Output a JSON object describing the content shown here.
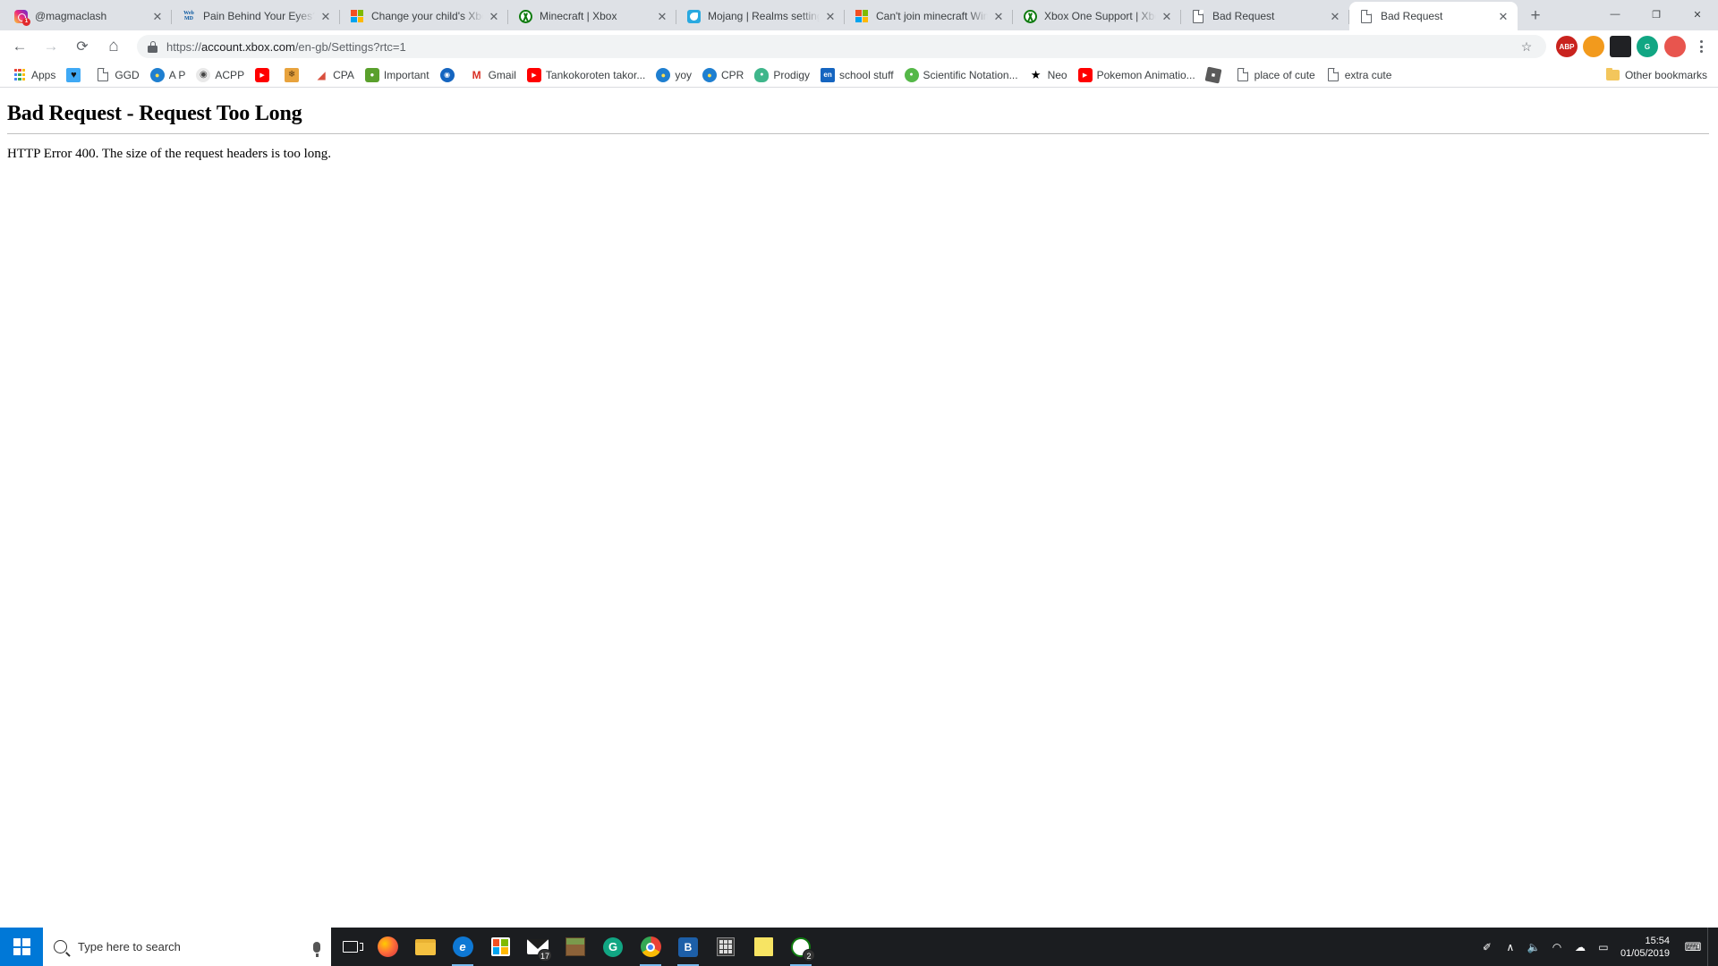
{
  "browser": {
    "tabs": [
      {
        "title": "@magmaclash",
        "favicon": "instagram-icon",
        "badge": "1",
        "active": false
      },
      {
        "title": "Pain Behind Your Eyes?",
        "favicon": "webmd-icon",
        "active": false
      },
      {
        "title": "Change your child's Xbox",
        "favicon": "microsoft-icon",
        "active": false
      },
      {
        "title": "Minecraft | Xbox",
        "favicon": "xbox-icon",
        "active": false
      },
      {
        "title": "Mojang | Realms settings",
        "favicon": "mojang-icon",
        "active": false
      },
      {
        "title": "Can't join minecraft Win",
        "favicon": "microsoft-icon",
        "active": false
      },
      {
        "title": "Xbox One Support | Xbox",
        "favicon": "xbox-icon",
        "active": false
      },
      {
        "title": "Bad Request",
        "favicon": "generic-page-icon",
        "active": false
      },
      {
        "title": "Bad Request",
        "favicon": "generic-page-icon",
        "active": true
      }
    ],
    "new_tab_label": "+",
    "window_controls": {
      "minimize": "—",
      "maximize": "❐",
      "close": "✕"
    },
    "toolbar": {
      "back_label": "←",
      "forward_label": "→",
      "reload_label": "⟳",
      "home_label": "⌂",
      "url_scheme": "https://",
      "url_host": "account.xbox.com",
      "url_path": "/en-gb/Settings?rtc=1",
      "url_full": "https://account.xbox.com/en-gb/Settings?rtc=1",
      "bookmark_star": "☆",
      "menu_label": "⋮",
      "profile_initial": "",
      "extensions": [
        {
          "name": "abp-extension",
          "label": "ABP",
          "color": "#c9231e"
        },
        {
          "name": "honey-extension",
          "label": "",
          "color": "#f29a1d"
        },
        {
          "name": "dark-extension",
          "label": "",
          "color": "#202124"
        },
        {
          "name": "grammarly-extension",
          "label": "G",
          "color": "#11a683"
        }
      ]
    },
    "bookmarks_bar": {
      "apps_label": "Apps",
      "other_bookmarks_label": "Other bookmarks",
      "items": [
        {
          "label": "",
          "icon": "heart-icon",
          "icon_color": "#3fa9f5",
          "glyph": "♥"
        },
        {
          "label": "GGD",
          "icon": "generic-page-icon",
          "icon_color": "#ffffff",
          "glyph": ""
        },
        {
          "label": "A P",
          "icon": "club-penguin-icon",
          "icon_color": "#1f7fd0",
          "glyph": ""
        },
        {
          "label": "ACPP",
          "icon": "stormtrooper-icon",
          "icon_color": "#e9e9e9",
          "glyph": ""
        },
        {
          "label": "",
          "icon": "youtube-icon",
          "icon_color": "#ff0000",
          "glyph": "▶"
        },
        {
          "label": "",
          "icon": "paw-icon",
          "icon_color": "#e8a33d",
          "glyph": ""
        },
        {
          "label": "CPA",
          "icon": "rocket-icon",
          "icon_color": "#d94f3d",
          "glyph": ""
        },
        {
          "label": "Important",
          "icon": "frog-icon",
          "icon_color": "#5aa02c",
          "glyph": ""
        },
        {
          "label": "",
          "icon": "disc-icon",
          "icon_color": "#1565c0",
          "glyph": ""
        },
        {
          "label": "Gmail",
          "icon": "gmail-icon",
          "icon_color": "#d93025",
          "glyph": "M"
        },
        {
          "label": "Tankokoroten takor...",
          "icon": "youtube-icon",
          "icon_color": "#ff0000",
          "glyph": "▶"
        },
        {
          "label": "yoy",
          "icon": "club-penguin-icon",
          "icon_color": "#1f7fd0",
          "glyph": ""
        },
        {
          "label": "CPR",
          "icon": "club-penguin-icon",
          "icon_color": "#1f7fd0",
          "glyph": ""
        },
        {
          "label": "Prodigy",
          "icon": "prodigy-icon",
          "icon_color": "#3fb68b",
          "glyph": ""
        },
        {
          "label": "school stuff",
          "icon": "education-icon",
          "icon_color": "#1565c0",
          "glyph": "en"
        },
        {
          "label": "Scientific Notation...",
          "icon": "dot-icon",
          "icon_color": "#55b848",
          "glyph": ""
        },
        {
          "label": "Neo",
          "icon": "star-icon",
          "icon_color": "#000000",
          "glyph": "★"
        },
        {
          "label": "Pokemon Animatio...",
          "icon": "youtube-icon",
          "icon_color": "#ff0000",
          "glyph": "▶"
        },
        {
          "label": "",
          "icon": "roblox-icon",
          "icon_color": "#5a5a5a",
          "glyph": ""
        },
        {
          "label": "place of cute",
          "icon": "generic-page-icon",
          "icon_color": "#ffffff",
          "glyph": ""
        },
        {
          "label": "extra cute",
          "icon": "generic-page-icon",
          "icon_color": "#ffffff",
          "glyph": ""
        }
      ]
    }
  },
  "page": {
    "heading": "Bad Request - Request Too Long",
    "body": "HTTP Error 400. The size of the request headers is too long."
  },
  "taskbar": {
    "start_label": "start-button",
    "search_placeholder": "Type here to search",
    "task_view_label": "task-view",
    "apps": [
      {
        "name": "firefox-taskbar-icon",
        "badge": ""
      },
      {
        "name": "file-explorer-taskbar-icon",
        "badge": ""
      },
      {
        "name": "edge-taskbar-icon",
        "badge": ""
      },
      {
        "name": "microsoft-store-taskbar-icon",
        "badge": ""
      },
      {
        "name": "mail-taskbar-icon",
        "badge": "17"
      },
      {
        "name": "minecraft-taskbar-icon",
        "badge": ""
      },
      {
        "name": "grammarly-taskbar-icon",
        "badge": ""
      },
      {
        "name": "chrome-taskbar-icon",
        "badge": ""
      },
      {
        "name": "bluestacks-taskbar-icon",
        "badge": ""
      },
      {
        "name": "calculator-taskbar-icon",
        "badge": ""
      },
      {
        "name": "sticky-notes-taskbar-icon",
        "badge": ""
      },
      {
        "name": "xbox-taskbar-icon",
        "badge": "2"
      }
    ],
    "tray": {
      "pen_icon": "✐",
      "chevron_icon": "∧",
      "volume_icon": "🔈",
      "wifi_icon": "◠",
      "cloud_icon": "☁",
      "battery_icon": "▭",
      "time": "15:54",
      "date": "01/05/2019",
      "notification_icon": "⌨"
    }
  }
}
